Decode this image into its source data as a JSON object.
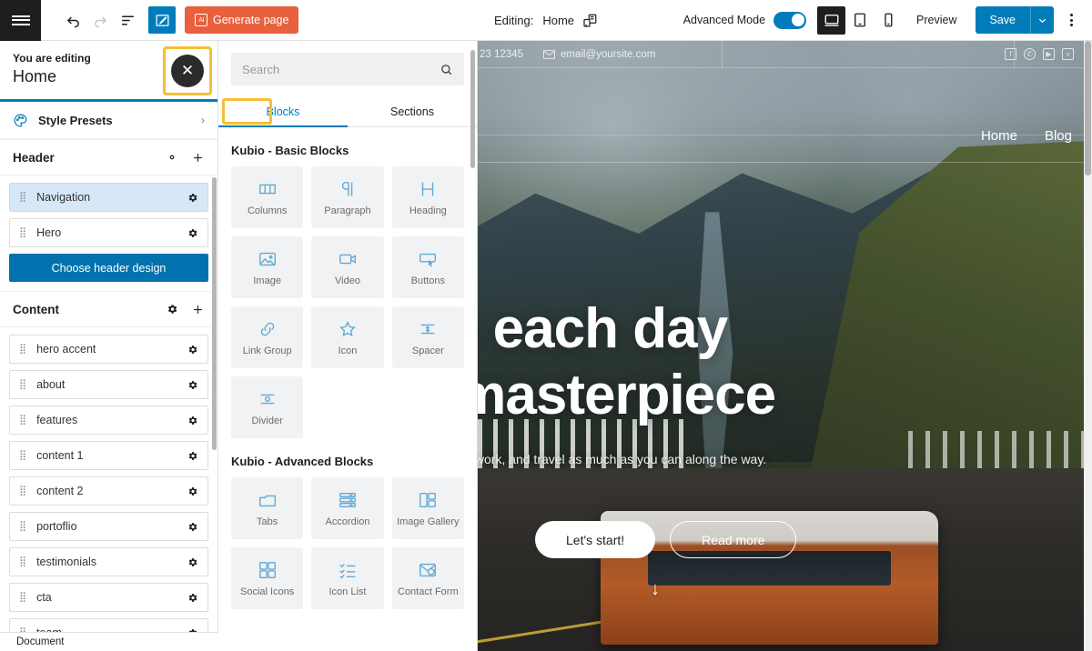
{
  "toolbar": {
    "menu_icon": "hamburger-icon",
    "undo_label": "Undo",
    "redo_label": "Redo",
    "list_view_label": "List view",
    "edit_tool_label": "Edit",
    "generate_page_label": "Generate page",
    "generate_page_icon_text": "AI",
    "generate_page_color": "#e8603c",
    "editing_label": "Editing:",
    "editing_page": "Home",
    "page_switcher_icon": "page-switch-icon",
    "advanced_mode_label": "Advanced Mode",
    "advanced_mode_on": true,
    "accent_color": "#007cba",
    "devices": [
      {
        "name": "desktop",
        "active": true
      },
      {
        "name": "tablet",
        "active": false
      },
      {
        "name": "mobile",
        "active": false
      }
    ],
    "preview_label": "Preview",
    "save_label": "Save",
    "save_caret": "⌄",
    "more_options_label": "More options"
  },
  "sidebar": {
    "editing_prefix": "You are editing",
    "page_name": "Home",
    "close_label": "✕",
    "style_presets_label": "Style Presets",
    "style_presets_chevron": "›",
    "sections": [
      {
        "title": "Header",
        "settings_icon": "gear-icon",
        "add_icon": "plus-icon",
        "items": [
          {
            "label": "Navigation",
            "active": true
          },
          {
            "label": "Hero",
            "active": false
          }
        ],
        "cta_label": "Choose header design"
      },
      {
        "title": "Content",
        "settings_icon": "gear-icon",
        "add_icon": "plus-icon",
        "items": [
          {
            "label": "hero accent",
            "active": false
          },
          {
            "label": "about",
            "active": false
          },
          {
            "label": "features",
            "active": false
          },
          {
            "label": "content 1",
            "active": false
          },
          {
            "label": "content 2",
            "active": false
          },
          {
            "label": "portoflio",
            "active": false
          },
          {
            "label": "testimonials",
            "active": false
          },
          {
            "label": "cta",
            "active": false
          },
          {
            "label": "team",
            "active": false
          }
        ]
      }
    ]
  },
  "status_bar": {
    "label": "Document"
  },
  "panel": {
    "search_placeholder": "Search",
    "search_value": "",
    "search_icon": "search-icon",
    "tabs": [
      {
        "label": "Blocks",
        "active": true
      },
      {
        "label": "Sections",
        "active": false
      }
    ],
    "groups": [
      {
        "title": "Kubio - Basic Blocks",
        "blocks": [
          {
            "label": "Columns",
            "icon": "columns-icon"
          },
          {
            "label": "Paragraph",
            "icon": "paragraph-icon"
          },
          {
            "label": "Heading",
            "icon": "heading-icon"
          },
          {
            "label": "Image",
            "icon": "image-icon"
          },
          {
            "label": "Video",
            "icon": "video-icon"
          },
          {
            "label": "Buttons",
            "icon": "buttons-icon"
          },
          {
            "label": "Link Group",
            "icon": "link-icon"
          },
          {
            "label": "Icon",
            "icon": "star-icon"
          },
          {
            "label": "Spacer",
            "icon": "spacer-icon"
          },
          {
            "label": "Divider",
            "icon": "divider-icon"
          }
        ]
      },
      {
        "title": "Kubio - Advanced Blocks",
        "blocks": [
          {
            "label": "Tabs",
            "icon": "tabs-icon"
          },
          {
            "label": "Accordion",
            "icon": "accordion-icon"
          },
          {
            "label": "Image Gallery",
            "icon": "gallery-icon"
          },
          {
            "label": "Social Icons",
            "icon": "social-icons-icon"
          },
          {
            "label": "Icon List",
            "icon": "icon-list-icon"
          },
          {
            "label": "Contact Form",
            "icon": "contact-form-icon"
          }
        ]
      }
    ]
  },
  "preview": {
    "topbar": {
      "phone": "23 12345",
      "email": "email@yoursite.com",
      "email_icon": "mail-icon",
      "social": [
        {
          "name": "facebook-icon",
          "glyph": "f"
        },
        {
          "name": "whatsapp-icon",
          "glyph": "✆"
        },
        {
          "name": "youtube-icon",
          "glyph": "▶"
        },
        {
          "name": "twitter-icon",
          "glyph": "ᴠ"
        }
      ]
    },
    "nav": [
      {
        "label": "Home"
      },
      {
        "label": "Blog"
      }
    ],
    "hero": {
      "title_line1": "ake each day",
      "title_line2": "ur masterpiece",
      "subtitle": "ve, don't live to work, and travel as much as you can along the way.",
      "primary_button": "Let's start!",
      "secondary_button": "Read more",
      "scroll_arrow": "↓"
    }
  }
}
